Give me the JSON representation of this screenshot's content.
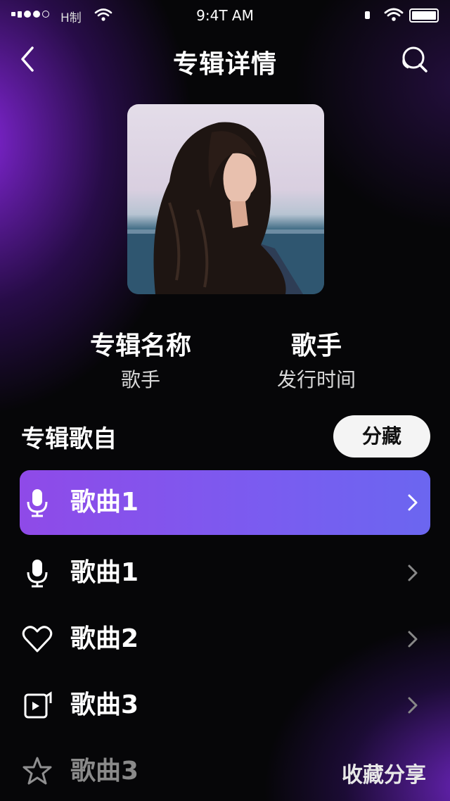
{
  "status_bar": {
    "carrier": "H制",
    "time": "9:4T AM"
  },
  "nav": {
    "title": "专辑详情",
    "back_icon": "chevron-left-icon",
    "search_icon": "search-icon"
  },
  "album": {
    "cover_alt": "album-cover-photo",
    "name": "专辑名称",
    "artist": "歌手",
    "singer": "歌手",
    "release": "发行时间"
  },
  "songs_section": {
    "title": "专辑歌自",
    "collect_label": "分藏"
  },
  "songs": [
    {
      "label": "歌曲1",
      "icon": "microphone-icon",
      "active": true
    },
    {
      "label": "歌曲1",
      "icon": "microphone-icon",
      "active": false
    },
    {
      "label": "歌曲2",
      "icon": "heart-icon",
      "active": false
    },
    {
      "label": "歌曲3",
      "icon": "video-icon",
      "active": false
    },
    {
      "label": "歌曲3",
      "icon": "star-icon",
      "active": false
    }
  ],
  "footer": {
    "share_label": "收藏分享"
  },
  "colors": {
    "accent_start": "#8f4ae8",
    "accent_end": "#6b66f0",
    "background": "#060608"
  }
}
